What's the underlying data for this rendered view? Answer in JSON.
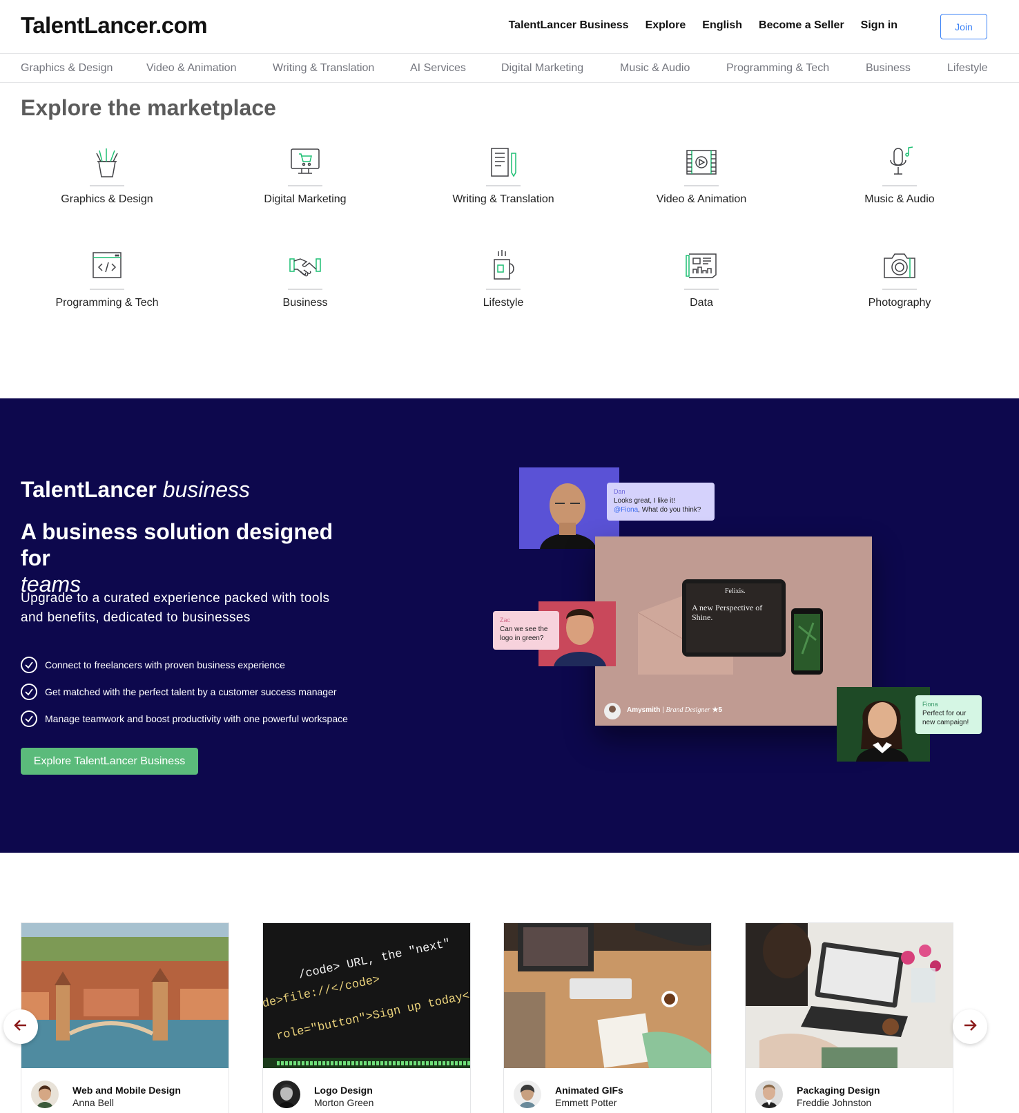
{
  "header": {
    "logo": "TalentLancer.com",
    "nav": [
      "TalentLancer Business",
      "Explore",
      "English",
      "Become a Seller",
      "Sign in"
    ],
    "join_label": "Join"
  },
  "categories": [
    "Graphics & Design",
    "Video & Animation",
    "Writing & Translation",
    "AI Services",
    "Digital Marketing",
    "Music & Audio",
    "Programming & Tech",
    "Business",
    "Lifestyle"
  ],
  "marketplace": {
    "title": "Explore the marketplace",
    "items": [
      {
        "label": "Graphics & Design",
        "icon": "pencil-cup-icon"
      },
      {
        "label": "Digital Marketing",
        "icon": "monitor-cart-icon"
      },
      {
        "label": "Writing & Translation",
        "icon": "document-pen-icon"
      },
      {
        "label": "Video & Animation",
        "icon": "film-play-icon"
      },
      {
        "label": "Music & Audio",
        "icon": "microphone-note-icon"
      },
      {
        "label": "Programming & Tech",
        "icon": "code-window-icon"
      },
      {
        "label": "Business",
        "icon": "handshake-icon"
      },
      {
        "label": "Lifestyle",
        "icon": "coffee-mug-icon"
      },
      {
        "label": "Data",
        "icon": "data-dashboard-icon"
      },
      {
        "label": "Photography",
        "icon": "camera-icon"
      }
    ]
  },
  "business": {
    "brand_main": "TalentLancer",
    "brand_italic": "business",
    "headline": "A business solution designed for",
    "headline_italic": "teams",
    "subtitle": "Upgrade to a curated experience packed with tools and benefits, dedicated to businesses",
    "features": [
      "Connect to freelancers with proven business experience",
      "Get matched with the perfect talent by a customer success manager",
      "Manage teamwork and boost productivity with one powerful workspace"
    ],
    "cta_label": "Explore TalentLancer Business",
    "collage": {
      "dan_name": "Dan",
      "dan_line1": "Looks great, I like it!",
      "dan_mention": "@Fiona",
      "dan_line2": ", What do you think?",
      "zac_name": "Zac",
      "zac_msg": "Can we see the logo in green?",
      "fiona_name": "Fiona",
      "fiona_msg": "Perfect for our new campaign!",
      "tablet_brand": "Felixis.",
      "tablet_headline": "A new Perspective of Shine.",
      "designer_name": "Amysmith",
      "designer_role": "Brand Designer",
      "designer_rating": "★5"
    },
    "colors": {
      "background": "#0d084d",
      "cta": "#5bbb7b"
    }
  },
  "gigs": [
    {
      "title": "Web and Mobile Design",
      "author": "Anna Bell"
    },
    {
      "title": "Logo Design",
      "author": "Morton Green"
    },
    {
      "title": "Animated GIFs",
      "author": "Emmett Potter"
    },
    {
      "title": "Packaging Design",
      "author": "Freddie Johnston"
    }
  ],
  "code_image": {
    "line1": "/code> URL, the \"next\"",
    "line2": "de>file://</code>",
    "line3": "role=\"button\">Sign up today</a></p"
  }
}
